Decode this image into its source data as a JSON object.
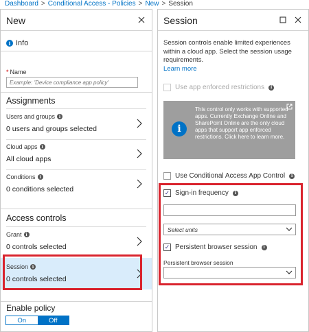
{
  "breadcrumb": {
    "items": [
      "Dashboard",
      "Conditional Access - Policies",
      "New"
    ],
    "current": "Session",
    "separator": ">"
  },
  "left": {
    "title": "New",
    "info_label": "Info",
    "name_label": "Name",
    "name_placeholder": "Example: 'Device compliance app policy'",
    "assignments_title": "Assignments",
    "items": [
      {
        "label": "Users and groups",
        "value": "0 users and groups selected"
      },
      {
        "label": "Cloud apps",
        "value": "All cloud apps"
      },
      {
        "label": "Conditions",
        "value": "0 conditions selected"
      }
    ],
    "access_title": "Access controls",
    "access_items": [
      {
        "label": "Grant",
        "value": "0 controls selected"
      },
      {
        "label": "Session",
        "value": "0 controls selected"
      }
    ],
    "enable_label": "Enable policy",
    "toggle_on": "On",
    "toggle_off": "Off"
  },
  "right": {
    "title": "Session",
    "description": "Session controls enable limited experiences within a cloud app. Select the session usage requirements.",
    "learn_more": "Learn more",
    "app_enforced_label": "Use app enforced restrictions",
    "notice_text": "This control only works with supported apps. Currently Exchange Online and SharePoint Online are the only cloud apps that support app enforced restrictions. Click here to learn more.",
    "caac_label": "Use Conditional Access App Control",
    "signin_label": "Sign-in frequency",
    "select_units": "Select units",
    "persistent_label": "Persistent browser session",
    "persistent_select_label": "Persistent browser session"
  },
  "colors": {
    "accent": "#0072c6",
    "highlight": "#d9232d",
    "selected_bg": "#d9ecfb"
  }
}
